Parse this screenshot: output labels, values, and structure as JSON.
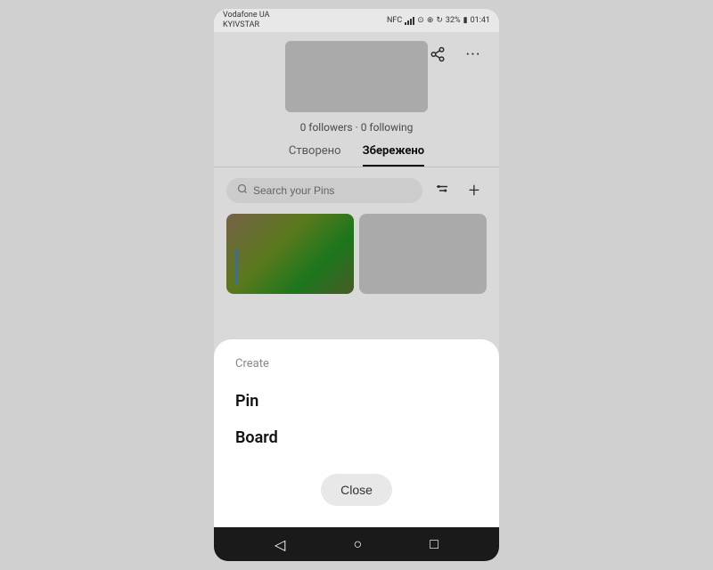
{
  "statusBar": {
    "carrier1": "Vodafone UA",
    "carrier2": "KYIVSTAR",
    "battery": "32%",
    "time": "01:41"
  },
  "profile": {
    "followers": "0 followers · 0 following"
  },
  "tabs": [
    {
      "label": "Створено",
      "active": false
    },
    {
      "label": "Збережено",
      "active": true
    }
  ],
  "search": {
    "placeholder": "Search your Pins"
  },
  "topActions": {
    "share": "⬆",
    "more": "···"
  },
  "bottomSheet": {
    "title": "Create",
    "items": [
      "Pin",
      "Board"
    ],
    "closeLabel": "Close"
  },
  "bottomNav": {
    "back": "◁",
    "home": "○",
    "recent": "□"
  }
}
